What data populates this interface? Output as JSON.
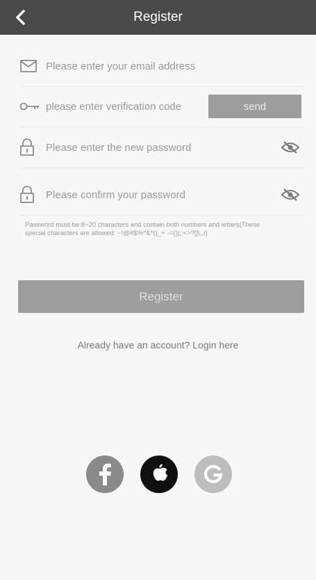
{
  "header": {
    "title": "Register"
  },
  "form": {
    "email_placeholder": "Please enter your email address",
    "code_placeholder": "please enter verification code",
    "send_label": "send",
    "password_placeholder": "Please enter the new password",
    "confirm_placeholder": "Please confirm your password",
    "hint": "Password must be 8~20 characters and contain both numbers and letters(These special characters are allowed: ~!@#$%^&*()_+`-={}|;:<>?[]\\,./)"
  },
  "register_label": "Register",
  "login_prompt": "Already have an account? Login here",
  "social": [
    {
      "name": "facebook",
      "color": "#8a8a8a"
    },
    {
      "name": "apple",
      "color": "#0f0f0f"
    },
    {
      "name": "google",
      "color": "#bdbdbd"
    }
  ]
}
